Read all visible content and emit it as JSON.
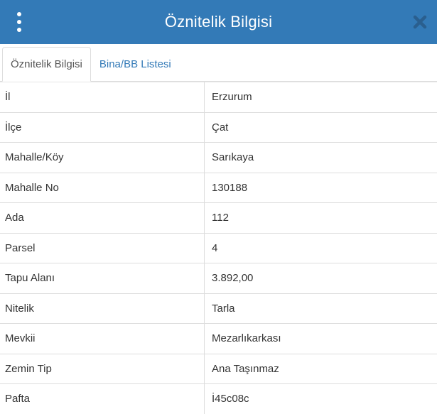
{
  "header": {
    "title": "Öznitelik Bilgisi",
    "menu_icon": "kebab-menu-icon",
    "close_icon": "close-icon",
    "background_color": "#337ab7"
  },
  "tabs": [
    {
      "label": "Öznitelik Bilgisi",
      "active": true
    },
    {
      "label": "Bina/BB Listesi",
      "active": false
    }
  ],
  "attributes": [
    {
      "key": "İl",
      "value": "Erzurum"
    },
    {
      "key": "İlçe",
      "value": "Çat"
    },
    {
      "key": "Mahalle/Köy",
      "value": "Sarıkaya"
    },
    {
      "key": "Mahalle No",
      "value": "130188"
    },
    {
      "key": "Ada",
      "value": "112"
    },
    {
      "key": "Parsel",
      "value": "4"
    },
    {
      "key": "Tapu Alanı",
      "value": "3.892,00"
    },
    {
      "key": "Nitelik",
      "value": "Tarla"
    },
    {
      "key": "Mevkii",
      "value": "Mezarlıkarkası"
    },
    {
      "key": "Zemin Tip",
      "value": "Ana Taşınmaz"
    },
    {
      "key": "Pafta",
      "value": "İ45c08c"
    }
  ]
}
